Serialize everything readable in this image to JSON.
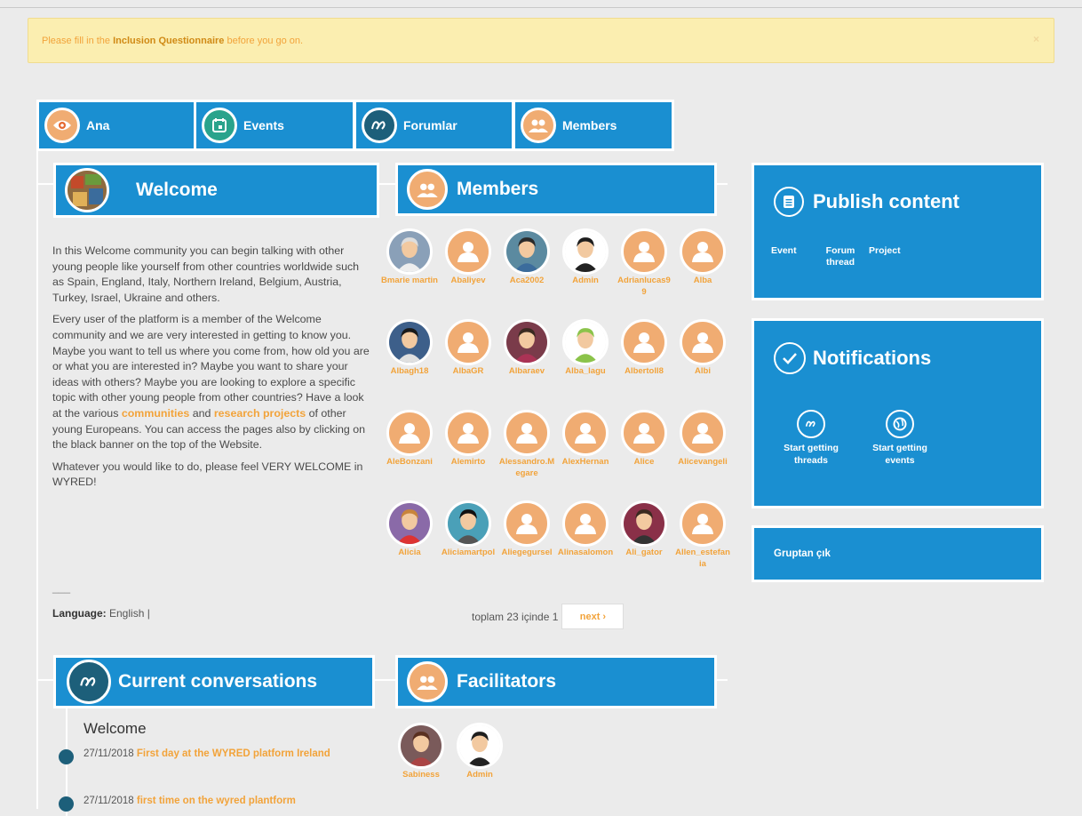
{
  "alert": {
    "prefix": "Please fill in the ",
    "bold": "Inclusion Questionnaire",
    "suffix": " before you go on.",
    "close": "×"
  },
  "tabs": [
    {
      "label": "Ana",
      "icon": "eye-icon"
    },
    {
      "label": "Events",
      "icon": "calendar-icon"
    },
    {
      "label": "Forumlar",
      "icon": "forum-icon"
    },
    {
      "label": "Members",
      "icon": "people-icon"
    }
  ],
  "welcome": {
    "title": "Welcome",
    "p1": "In this Welcome community you can begin talking with other young people like yourself from other countries worldwide such as  Spain, England, Italy, Northern Ireland, Belgium, Austria, Turkey, Israel, Ukraine and others.",
    "p2_a": "Every user of the platform is a member of the Welcome community and we are very interested in getting to know you. Maybe you want to tell us where you come from, how old you are or what you are interested in? Maybe you want to share your ideas with others? Maybe you are looking to explore a specific topic with other young people from other countries? Have a look at the various ",
    "p2_link1": "communities",
    "p2_b": " and ",
    "p2_link2": "research projects",
    "p2_c": " of other young Europeans. You can access the pages also by clicking on the black banner on the top of the Website.",
    "p3": "Whatever you would like to do, please feel VERY WELCOME in WYRED!",
    "dash": "___",
    "language_label": "Language:",
    "language_value": " English |"
  },
  "members": {
    "title": "Members",
    "list": [
      {
        "name": "Bmarie martin",
        "type": "photo-old"
      },
      {
        "name": "Abaliyev",
        "type": "default"
      },
      {
        "name": "Aca2002",
        "type": "photo-boy"
      },
      {
        "name": "Admin",
        "type": "photo-girl"
      },
      {
        "name": "Adrianlucas99",
        "type": "default"
      },
      {
        "name": "Alba",
        "type": "default"
      },
      {
        "name": "Albagh18",
        "type": "photo-boy2"
      },
      {
        "name": "AlbaGR",
        "type": "default"
      },
      {
        "name": "Albaraev",
        "type": "photo-girl2"
      },
      {
        "name": "Alba_lagu",
        "type": "photo-alien"
      },
      {
        "name": "Albertoll8",
        "type": "default"
      },
      {
        "name": "Albi",
        "type": "default"
      },
      {
        "name": "AleBonzani",
        "type": "default"
      },
      {
        "name": "Alemirto",
        "type": "default"
      },
      {
        "name": "Alessandro.Megare",
        "type": "default"
      },
      {
        "name": "AlexHernan",
        "type": "default"
      },
      {
        "name": "Alice",
        "type": "default"
      },
      {
        "name": "Alicevangeli",
        "type": "default"
      },
      {
        "name": "Alicia",
        "type": "photo-girl3"
      },
      {
        "name": "Aliciamartpol",
        "type": "photo-girl4"
      },
      {
        "name": "Aliegegursel",
        "type": "default"
      },
      {
        "name": "Alinasalomon",
        "type": "default"
      },
      {
        "name": "Ali_gator",
        "type": "photo-man"
      },
      {
        "name": "Allen_estefania",
        "type": "default"
      }
    ],
    "pager_text": "toplam 23 içinde 1",
    "next": "next ›"
  },
  "publish": {
    "title": "Publish content",
    "links": [
      "Event",
      "Forum thread",
      "Project"
    ]
  },
  "notifications": {
    "title": "Notifications",
    "items": [
      "Start getting threads",
      "Start getting events"
    ]
  },
  "leave_group": "Gruptan çık",
  "conversations": {
    "title": "Current conversations",
    "section": "Welcome",
    "items": [
      {
        "date": "27/11/2018 ",
        "title": "First day at the WYRED platform Ireland"
      },
      {
        "date": "27/11/2018 ",
        "title": "first time on the wyred plantform"
      }
    ]
  },
  "facilitators": {
    "title": "Facilitators",
    "list": [
      {
        "name": "Sabiness",
        "type": "photo-woman"
      },
      {
        "name": "Admin",
        "type": "photo-girl"
      }
    ]
  },
  "colors": {
    "blue": "#1a8fd1",
    "orange": "#f0ac72",
    "link_orange": "#f2a33a",
    "teal": "#2aa38c",
    "navy": "#1d5f7a",
    "alert_bg": "#fbeeb0"
  }
}
